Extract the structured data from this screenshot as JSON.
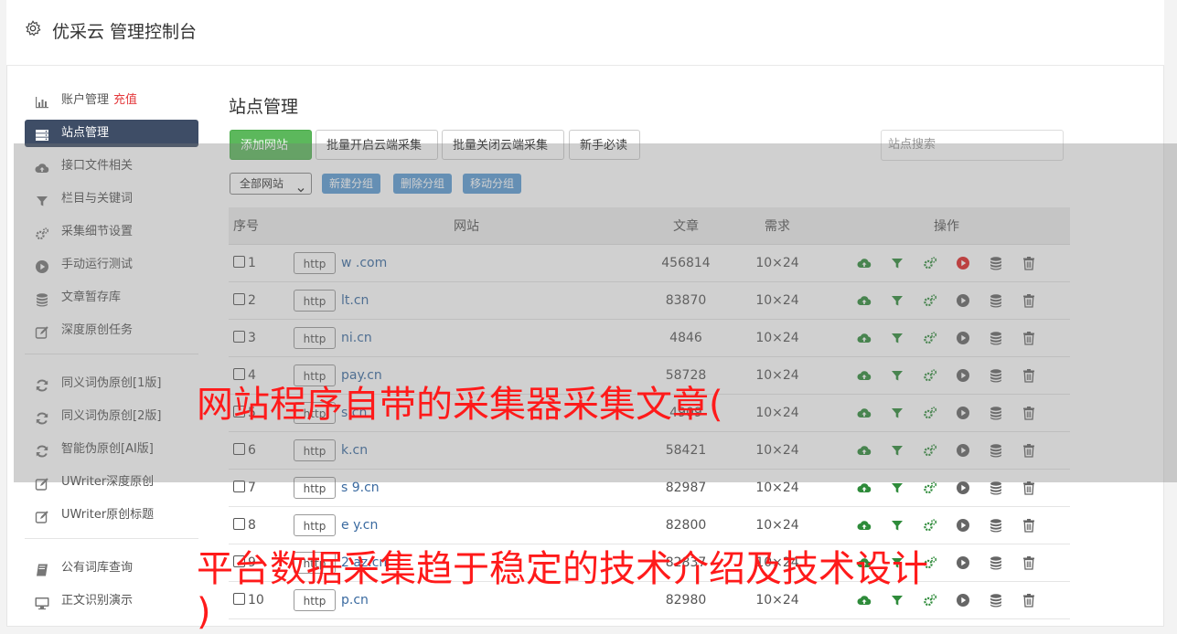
{
  "header": {
    "title": "优采云 管理控制台"
  },
  "sidebar": {
    "items": [
      {
        "label": "账户管理",
        "extra": "充值",
        "icon": "bar-chart-icon"
      },
      {
        "label": "站点管理",
        "icon": "server-icon",
        "active": true
      },
      {
        "label": "接口文件相关",
        "icon": "cloud-upload-icon"
      },
      {
        "label": "栏目与关键词",
        "icon": "filter-icon"
      },
      {
        "label": "采集细节设置",
        "icon": "cogs-icon"
      },
      {
        "label": "手动运行测试",
        "icon": "play-circle-icon"
      },
      {
        "label": "文章暂存库",
        "icon": "database-icon"
      },
      {
        "label": "深度原创任务",
        "icon": "edit-icon"
      }
    ],
    "items2": [
      {
        "label": "同义词伪原创[1版]",
        "icon": "refresh-icon"
      },
      {
        "label": "同义词伪原创[2版]",
        "icon": "refresh-icon"
      },
      {
        "label": "智能伪原创[AI版]",
        "icon": "refresh-icon"
      },
      {
        "label": "UWriter深度原创",
        "icon": "edit-icon"
      },
      {
        "label": "UWriter原创标题",
        "icon": "edit-icon"
      }
    ],
    "items3": [
      {
        "label": "公有词库查询",
        "icon": "book-icon"
      },
      {
        "label": "正文识别演示",
        "icon": "monitor-icon"
      }
    ]
  },
  "main": {
    "title": "站点管理",
    "buttons": {
      "add": "添加网站 +",
      "batch_open": "批量开启云端采集",
      "batch_close": "批量关闭云端采集",
      "newbie": "新手必读"
    },
    "search_placeholder": "站点搜索",
    "group_select": "全部网站",
    "group_buttons": {
      "new": "新建分组",
      "delete": "删除分组",
      "move": "移动分组"
    },
    "table": {
      "headers": [
        "序号",
        "网站",
        "文章",
        "需求",
        "操作"
      ],
      "rows": [
        {
          "no": "1",
          "http": "http",
          "site": "w        .com",
          "articles": "456814",
          "need": "10×24",
          "active_play": true
        },
        {
          "no": "2",
          "http": "http",
          "site": "lt.cn",
          "articles": "83870",
          "need": "10×24",
          "active_play": false
        },
        {
          "no": "3",
          "http": "http",
          "site": "ni.cn",
          "articles": "4846",
          "need": "10×24",
          "active_play": false
        },
        {
          "no": "4",
          "http": "http",
          "site": "pay.cn",
          "articles": "58728",
          "need": "10×24",
          "active_play": false
        },
        {
          "no": "5",
          "http": "http",
          "site": "s.cn",
          "articles": "4909",
          "need": "10×24",
          "active_play": false
        },
        {
          "no": "6",
          "http": "http",
          "site": "k.cn",
          "articles": "58421",
          "need": "10×24",
          "active_play": false
        },
        {
          "no": "7",
          "http": "http",
          "site": "s   9.cn",
          "articles": "82987",
          "need": "10×24",
          "active_play": false
        },
        {
          "no": "8",
          "http": "http",
          "site": "e    y.cn",
          "articles": "82800",
          "need": "10×24",
          "active_play": false
        },
        {
          "no": "9",
          "http": "http",
          "site": "2   az.cn",
          "articles": "82837",
          "need": "10×24",
          "active_play": false
        },
        {
          "no": "10",
          "http": "http",
          "site": "p.cn",
          "articles": "82980",
          "need": "10×24",
          "active_play": false
        }
      ]
    }
  },
  "watermarks": {
    "line1": "网站程序自带的采集器采集文章(",
    "line2": "平台数据采集趋于稳定的技术介绍及技术设计",
    "line3": ")"
  },
  "colors": {
    "sidebar_active": "#3e4d66",
    "add_button": "#5cb85c",
    "group_button": "#5b9bd5",
    "watermark": "#ff1a1a",
    "link": "#3a6aa0"
  }
}
